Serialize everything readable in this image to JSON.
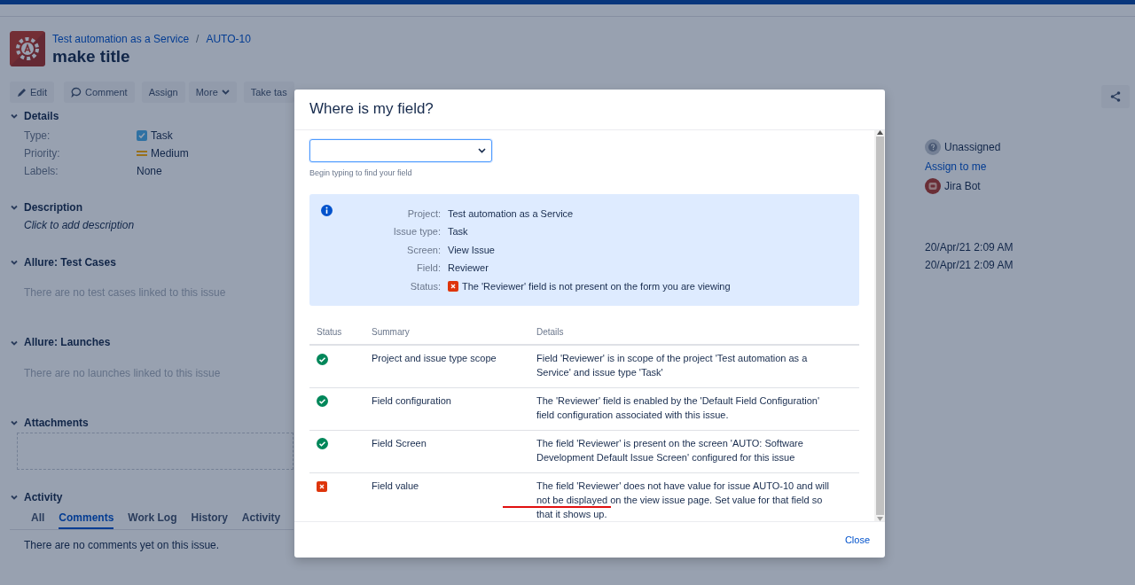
{
  "breadcrumb": {
    "project": "Test automation as a Service",
    "separator": "/",
    "issue_key": "AUTO-10"
  },
  "issue_title": "make title",
  "toolbar": [
    {
      "label": "Edit",
      "kind": "edit"
    },
    {
      "label": "Comment",
      "kind": "comment"
    },
    {
      "label": "Assign",
      "kind": "plain"
    },
    {
      "label": "More",
      "kind": "menu"
    },
    {
      "label": "Take tas",
      "kind": "plain"
    }
  ],
  "details": {
    "heading": "Details",
    "fields": [
      {
        "label": "Type:",
        "value": "Task",
        "kind": "type"
      },
      {
        "label": "Priority:",
        "value": "Medium",
        "kind": "priority"
      },
      {
        "label": "Labels:",
        "value": "None",
        "kind": "plain"
      }
    ]
  },
  "description": {
    "heading": "Description",
    "placeholder": "Click to add description"
  },
  "test_cases": {
    "heading": "Allure: Test Cases",
    "empty": "There are no test cases linked to this issue"
  },
  "launches": {
    "heading": "Allure: Launches",
    "empty": "There are no launches linked to this issue"
  },
  "attachments": {
    "heading": "Attachments"
  },
  "activity": {
    "heading": "Activity",
    "tabs": [
      {
        "label": "All",
        "selected": false
      },
      {
        "label": "Comments",
        "selected": true
      },
      {
        "label": "Work Log",
        "selected": false
      },
      {
        "label": "History",
        "selected": false
      },
      {
        "label": "Activity",
        "selected": false
      }
    ],
    "empty": "There are no comments yet on this issue."
  },
  "people": {
    "assignee": "Unassigned",
    "assign_link": "Assign to me",
    "reporter": "Jira Bot"
  },
  "dates": [
    "20/Apr/21 2:09 AM",
    "20/Apr/21 2:09 AM"
  ],
  "dialog": {
    "title": "Where is my field?",
    "select_hint": "Begin typing to find your field",
    "summary": [
      {
        "label": "Project:",
        "value": "Test automation as a Service",
        "kind": "text"
      },
      {
        "label": "Issue type:",
        "value": "Task",
        "kind": "text"
      },
      {
        "label": "Screen:",
        "value": "View Issue",
        "kind": "text"
      },
      {
        "label": "Field:",
        "value": "Reviewer",
        "kind": "text"
      },
      {
        "label": "Status:",
        "value": "The 'Reviewer' field is not present on the form you are viewing",
        "kind": "error"
      }
    ],
    "columns": [
      "Status",
      "Summary",
      "Details"
    ],
    "rows": [
      {
        "kind": "ok",
        "summary": "Project and issue type scope",
        "details": "Field 'Reviewer' is in scope of the project 'Test automation as a Service' and issue type 'Task'"
      },
      {
        "kind": "ok",
        "summary": "Field configuration",
        "details": "The 'Reviewer' field is enabled by the 'Default Field Configuration' field configuration associated with this issue."
      },
      {
        "kind": "ok",
        "summary": "Field Screen",
        "details": "The field 'Reviewer' is present on the screen 'AUTO: Software Development Default Issue Screen' configured for this issue"
      },
      {
        "kind": "error",
        "summary": "Field value",
        "details": "The field 'Reviewer' does not have value for issue AUTO-10 and will not be displayed on the view issue page. Set value for that field so that it shows up.",
        "annotated": true
      }
    ],
    "close": "Close"
  }
}
